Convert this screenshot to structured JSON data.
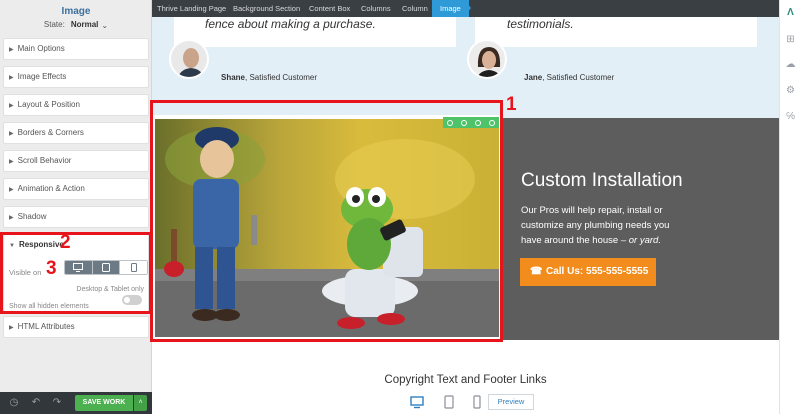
{
  "panel": {
    "title": "Image",
    "state_label": "State:",
    "state_value": "Normal",
    "sections": [
      {
        "label": "Main Options"
      },
      {
        "label": "Image Effects"
      },
      {
        "label": "Layout & Position"
      },
      {
        "label": "Borders & Corners"
      },
      {
        "label": "Scroll Behavior"
      },
      {
        "label": "Animation & Action"
      },
      {
        "label": "Shadow"
      }
    ],
    "responsive": {
      "label": "Responsive",
      "visible_on_label": "Visible on",
      "device_note": "Desktop & Tablet only",
      "show_hidden_label": "Show all hidden elements"
    },
    "html_attributes_label": "HTML Attributes",
    "save_label": "SAVE WORK"
  },
  "breadcrumb": [
    {
      "label": "Thrive Landing Page"
    },
    {
      "label": "Background Section"
    },
    {
      "label": "Content Box"
    },
    {
      "label": "Columns"
    },
    {
      "label": "Column"
    },
    {
      "label": "Image"
    }
  ],
  "canvas": {
    "testimonials": [
      {
        "quote": "fence about making a purchase.",
        "name": "Shane",
        "role": ", Satisfied Customer"
      },
      {
        "quote": "testimonials.",
        "name": "Jane",
        "role": ", Satisfied Customer"
      }
    ],
    "hero": {
      "title": "Custom Installation",
      "text": "Our Pros will help repair, install or customize any plumbing needs you have around the house –",
      "text_italic": "or yard.",
      "call_button": "Call Us: 555-555-5555"
    },
    "footer_text": "Copyright Text and Footer Links",
    "preview_label": "Preview"
  },
  "annotations": [
    "1",
    "2",
    "3"
  ],
  "colors": {
    "accent_blue": "#2f9ad8",
    "save_green": "#4caf50",
    "call_orange": "#f28c1c",
    "annotation_red": "#e8141c"
  }
}
